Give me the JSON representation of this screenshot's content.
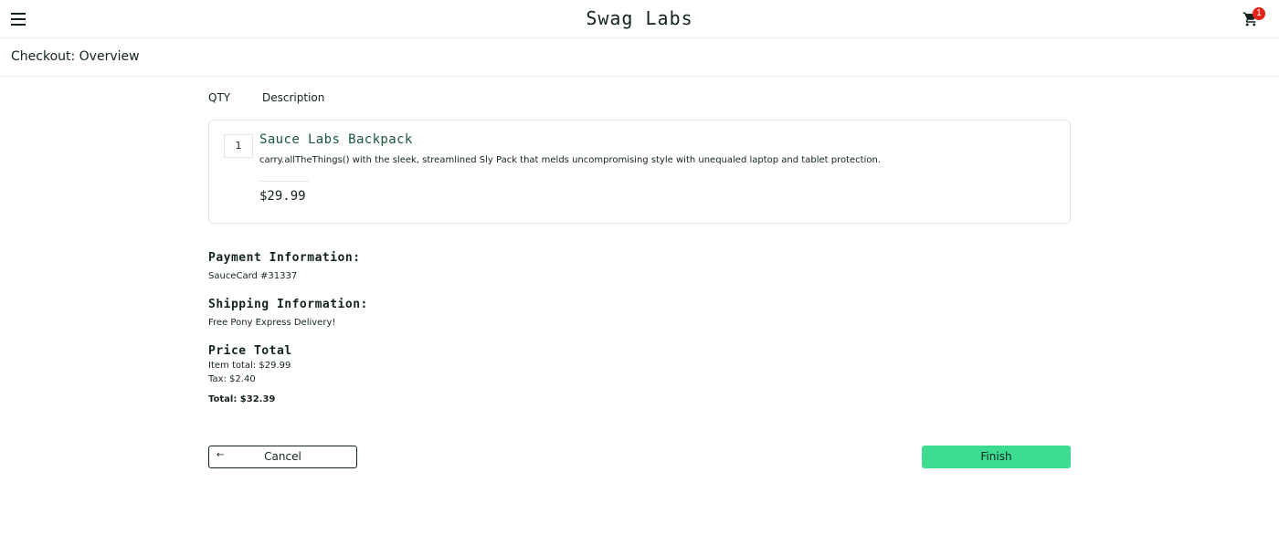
{
  "header": {
    "app_title": "Swag Labs",
    "menu_icon": "hamburger-menu-icon",
    "cart_icon": "shopping-cart-icon",
    "cart_badge_count": "1",
    "badge_color": "#e2231a"
  },
  "subheader": {
    "title": "Checkout: Overview"
  },
  "cart_list": {
    "qty_label": "QTY",
    "description_label": "Description",
    "items": [
      {
        "quantity": "1",
        "name": "Sauce Labs Backpack",
        "description": "carry.allTheThings() with the sleek, streamlined Sly Pack that melds uncompromising style with unequaled laptop and tablet protection.",
        "price": "$29.99"
      }
    ]
  },
  "summary": {
    "payment_label": "Payment Information:",
    "payment_value": "SauceCard #31337",
    "shipping_label": "Shipping Information:",
    "shipping_value": "Free Pony Express Delivery!",
    "price_total_label": "Price Total",
    "item_total": "Item total: $29.99",
    "tax": "Tax: $2.40",
    "total": "Total: $32.39"
  },
  "actions": {
    "cancel_label": "Cancel",
    "cancel_icon": "arrow-left-icon",
    "finish_label": "Finish",
    "finish_color": "#3ddc91"
  }
}
